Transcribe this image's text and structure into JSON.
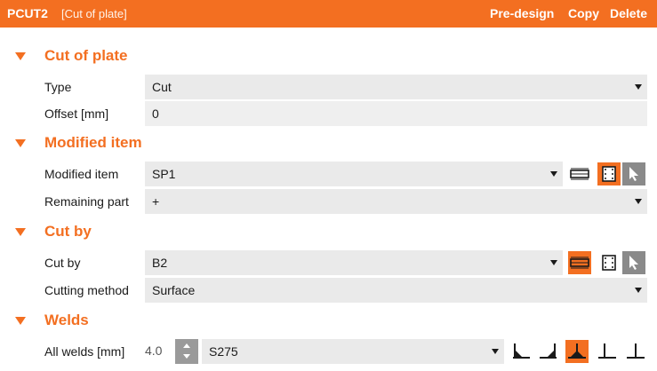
{
  "header": {
    "name": "PCUT2",
    "subtitle": "[Cut of plate]",
    "actions": {
      "predesign": "Pre-design",
      "copy": "Copy",
      "delete": "Delete"
    },
    "color": "#f36f21"
  },
  "sections": {
    "cut_of_plate": {
      "title": "Cut of plate",
      "type": {
        "label": "Type",
        "value": "Cut"
      },
      "offset": {
        "label": "Offset [mm]",
        "value": "0"
      }
    },
    "modified_item": {
      "title": "Modified item",
      "item": {
        "label": "Modified item",
        "value": "SP1",
        "icons": [
          "member-swap-icon",
          "plate-frame-icon",
          "pick-cursor-icon"
        ]
      },
      "remaining": {
        "label": "Remaining part",
        "value": "+"
      }
    },
    "cut_by": {
      "title": "Cut by",
      "cut_by": {
        "label": "Cut by",
        "value": "B2",
        "icons": [
          "member-swap-icon",
          "plate-frame-icon",
          "pick-cursor-icon"
        ]
      },
      "method": {
        "label": "Cutting method",
        "value": "Surface"
      }
    },
    "welds": {
      "title": "Welds",
      "all": {
        "label": "All welds [mm]",
        "size": "4.0",
        "material": "S275",
        "weld_types": [
          "fillet-weld-left-icon",
          "fillet-weld-right-icon",
          "double-fillet-weld-icon",
          "butt-weld-left-icon",
          "butt-weld-icon"
        ]
      }
    }
  }
}
